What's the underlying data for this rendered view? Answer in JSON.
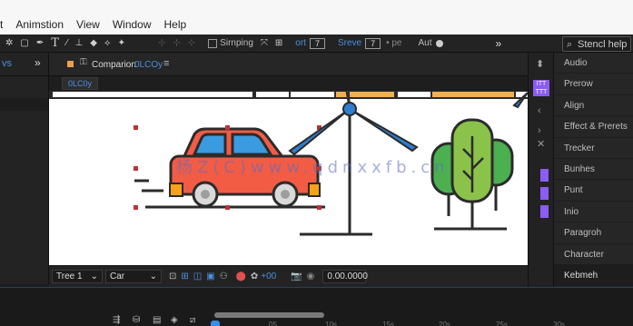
{
  "menu": {
    "items": [
      "t",
      "Animstion",
      "View",
      "Window",
      "Help"
    ]
  },
  "toolbar": {
    "snapping_label": "Sirnping",
    "field1_label": "ort",
    "field1_value": "7",
    "field2_label": "Sreve",
    "field2_value": "7",
    "field2_suffix": "• pe",
    "auto_label": "Aut"
  },
  "search": {
    "label": "Stencl help"
  },
  "left": {
    "tab": "vs"
  },
  "composition": {
    "tab_label": "Comparion",
    "tab_name": "0LCOy",
    "sub_tab": "0LC0y",
    "watermark": "杨Z(C)www.qdnxxfb.cn"
  },
  "viewer_bottom": {
    "layer_select": "Tree 1",
    "layer_select2": "Car",
    "exposure": "+00",
    "timecode": "0.00.0000"
  },
  "right_panel": {
    "items": [
      "Audio",
      "Prerow",
      "Align",
      "Effect & Prerets",
      "Trecker",
      "Bunhes",
      "Punt",
      "Inio",
      "Paragroh",
      "Character",
      "Kebmeh"
    ]
  },
  "timeline": {
    "ticks": [
      "05",
      "10s",
      "15s",
      "20s",
      "25s",
      "30s"
    ]
  },
  "colors": {
    "accent": "#4a8fe0",
    "purple": "#8b5cf6",
    "car_body": "#f25c45",
    "car_window": "#3b9be0",
    "tree_dark": "#4caf50",
    "tree_light": "#8bc34a",
    "turbine": "#2f7fd0",
    "banner_orange": "#f0b050"
  }
}
